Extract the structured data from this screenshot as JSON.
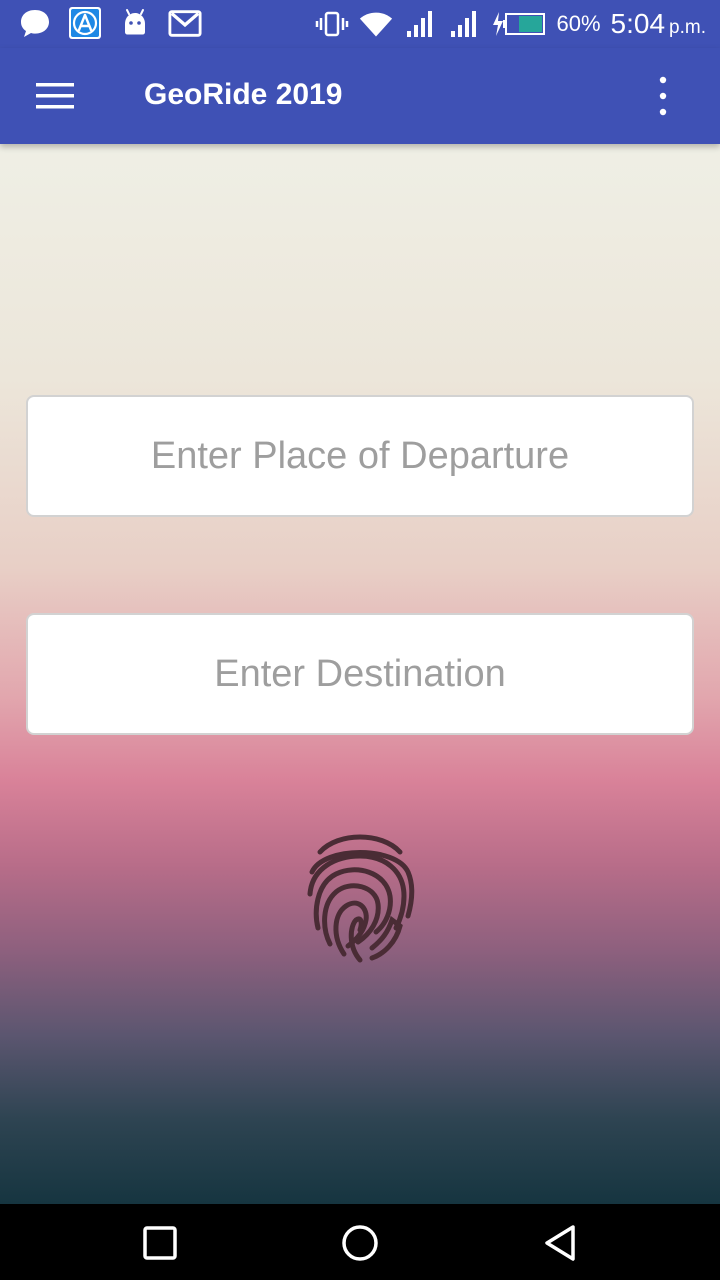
{
  "status_bar": {
    "notification_icons": [
      "chat-bubble-icon",
      "app-store-icon",
      "android-icon",
      "gmail-icon"
    ],
    "system_icons": [
      "vibrate-icon",
      "wifi-icon",
      "signal-icon",
      "signal-icon",
      "battery-charging-icon"
    ],
    "battery_percent": "60%",
    "time": "5:04",
    "time_suffix": "p.m."
  },
  "app_bar": {
    "title": "GeoRide 2019",
    "menu_icon": "hamburger-menu-icon",
    "overflow_icon": "more-vert-icon",
    "color": "#3f51b5"
  },
  "form": {
    "departure_placeholder": "Enter Place of Departure",
    "destination_placeholder": "Enter Destination",
    "fingerprint_icon": "fingerprint-icon"
  },
  "nav_bar": {
    "buttons": [
      "recents-square-icon",
      "home-circle-icon",
      "back-triangle-icon"
    ]
  }
}
